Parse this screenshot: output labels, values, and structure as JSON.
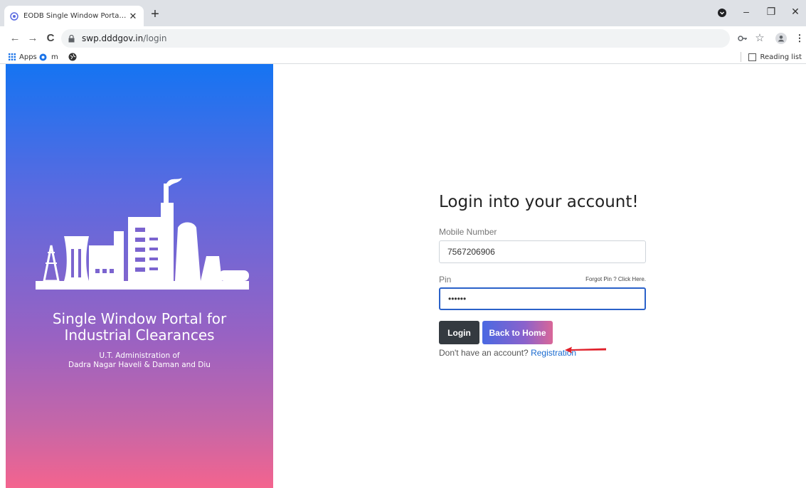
{
  "browser": {
    "tab_title": "EODB Single Window Portal : Da",
    "tab_close": "✕",
    "new_tab": "+",
    "url_host": "swp.dddgov.in",
    "url_path": "/login",
    "bookmarks": [
      {
        "label": "Apps"
      },
      {
        "label": "m"
      }
    ],
    "reading_list": "Reading list",
    "icons": {
      "back": "←",
      "forward": "→",
      "reload": "C",
      "key": "🔑",
      "star": "☆",
      "menu": "⋮",
      "minimize": "–",
      "restore": "❐",
      "close": "✕"
    }
  },
  "hero": {
    "title_line1": "Single Window Portal for",
    "title_line2": "Industrial Clearances",
    "sub_line1": "U.T. Administration of",
    "sub_line2": "Dadra Nagar Haveli & Daman and Diu",
    "gradient_top": "#1574f2",
    "gradient_bottom": "#f4648e"
  },
  "login": {
    "heading": "Login into your account!",
    "mobile_label": "Mobile Number",
    "mobile_value": "7567206906",
    "pin_label": "Pin",
    "pin_value": "••••••",
    "forgot_text": "Forgot Pin ? Click Here.",
    "login_button": "Login",
    "home_button": "Back to Home",
    "signup_prompt": "Don't have an account?",
    "registration_link": "Registration",
    "accent_color": "#2a61c9",
    "arrow_color": "#e0202a"
  }
}
